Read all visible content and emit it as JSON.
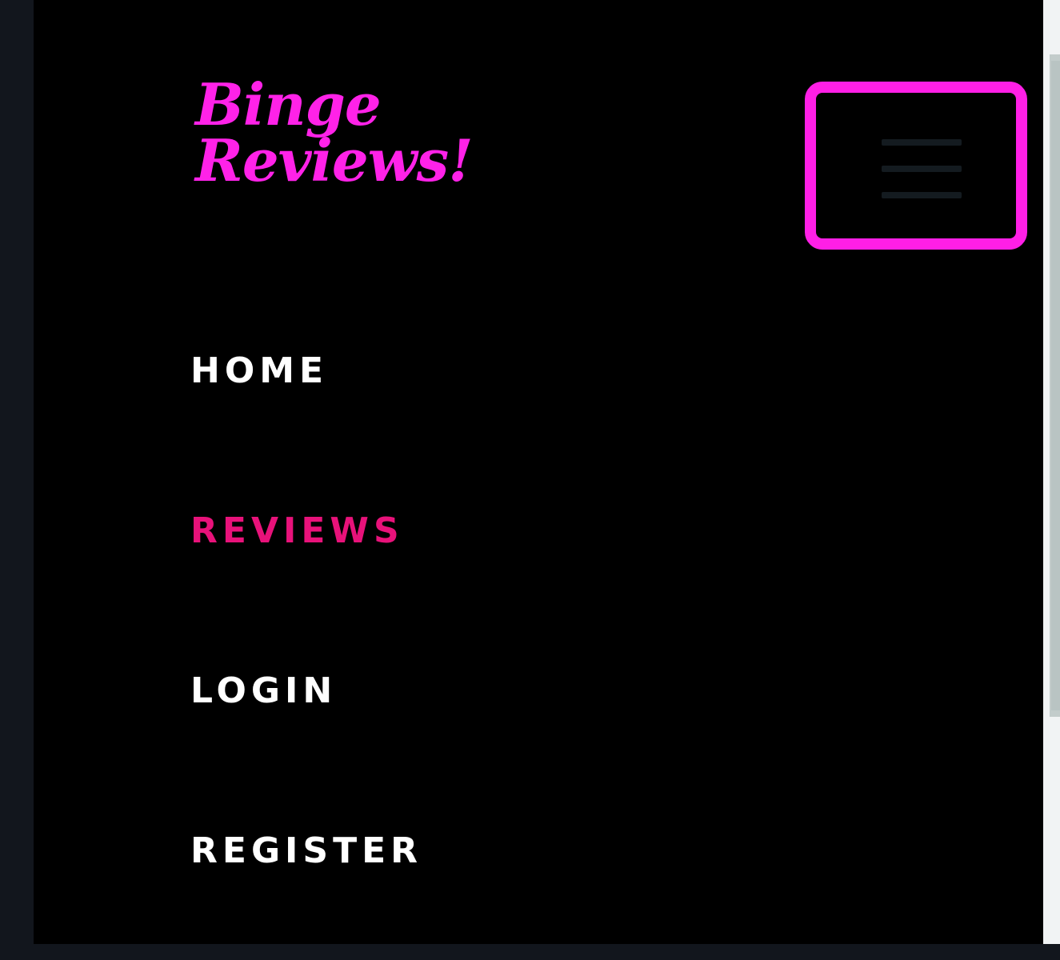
{
  "brand": {
    "line1": "Binge",
    "line2": "Reviews!"
  },
  "toggler": {
    "icon": "hamburger-menu-icon",
    "border_color": "#ff1fe6"
  },
  "nav": {
    "items": [
      {
        "label": "HOME",
        "active": false
      },
      {
        "label": "REVIEWS",
        "active": true
      },
      {
        "label": "LOGIN",
        "active": false
      },
      {
        "label": "REGISTER",
        "active": false
      }
    ]
  },
  "colors": {
    "brand": "#ff22e8",
    "active_link": "#e8127a",
    "link": "#ffffff",
    "background": "#000000"
  }
}
